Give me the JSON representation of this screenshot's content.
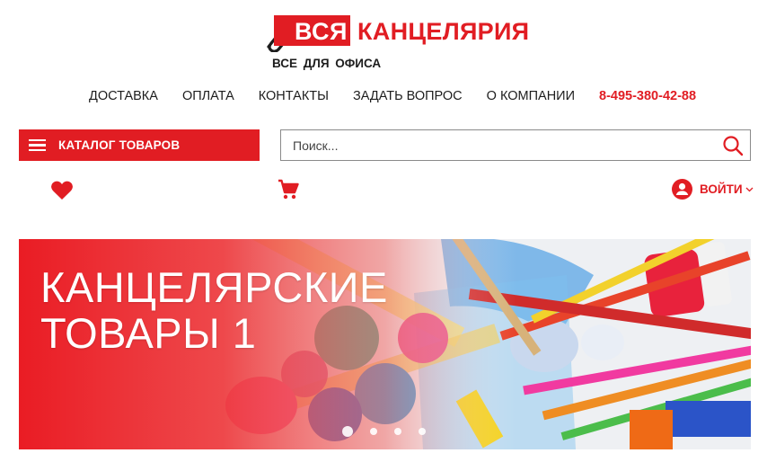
{
  "logo": {
    "word1": "ВСЯ",
    "word2": "КАНЦЕЛЯРИЯ",
    "tagline": "ВСЕ ДЛЯ ОФИСА",
    "brand_color": "#e11d23",
    "icon": "paperclip-icon"
  },
  "nav": {
    "items": [
      "ДОСТАВКА",
      "ОПЛАТА",
      "КОНТАКТЫ",
      "ЗАДАТЬ ВОПРОС",
      "О КОМПАНИИ"
    ],
    "phone": "8-495-380-42-88"
  },
  "catalog": {
    "label": "КАТАЛОГ ТОВАРОВ",
    "icon": "menu-icon"
  },
  "search": {
    "placeholder": "Поиск...",
    "value": "",
    "icon": "search-icon"
  },
  "toolbar": {
    "favorites_icon": "heart-icon",
    "cart_icon": "cart-icon",
    "login_label": "ВОЙТИ",
    "login_icon": "user-icon"
  },
  "banner": {
    "title_line1": "КАНЦЕЛЯРСКИЕ",
    "title_line2": "ТОВАРЫ 1",
    "slide_count": 4,
    "active_slide": 1
  }
}
